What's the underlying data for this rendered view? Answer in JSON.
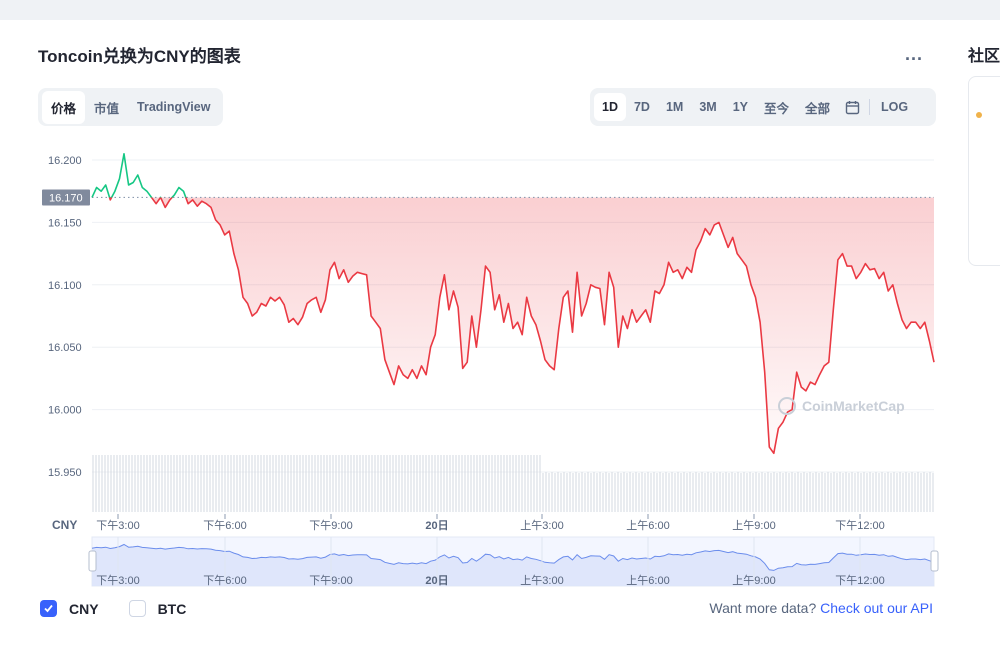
{
  "title": "Toncoin兑换为CNY的图表",
  "more_label": "...",
  "side_title": "社区",
  "view_tabs": [
    {
      "label": "价格",
      "active": true
    },
    {
      "label": "市值",
      "active": false
    },
    {
      "label": "TradingView",
      "active": false
    }
  ],
  "ranges": [
    {
      "label": "1D",
      "active": true
    },
    {
      "label": "7D",
      "active": false
    },
    {
      "label": "1M",
      "active": false
    },
    {
      "label": "3M",
      "active": false
    },
    {
      "label": "1Y",
      "active": false
    },
    {
      "label": "至今",
      "active": false
    },
    {
      "label": "全部",
      "active": false
    }
  ],
  "calendar_icon": "calendar-icon",
  "log_label": "LOG",
  "legend": [
    {
      "label": "CNY",
      "checked": true
    },
    {
      "label": "BTC",
      "checked": false
    }
  ],
  "api_text": "Want more data?",
  "api_link": "Check out our API",
  "watermark": "CoinMarketCap",
  "colors": {
    "up": "#16c784",
    "down": "#ea3943",
    "accent": "#3861fb",
    "nav_fill": "#dde4fb",
    "nav_line": "#6b8dec"
  },
  "chart_data": {
    "type": "line",
    "currency_label": "CNY",
    "ylim": [
      15.95,
      16.2
    ],
    "yticks": [
      "16.200",
      "16.150",
      "16.100",
      "16.050",
      "16.000",
      "15.950"
    ],
    "reference_price": "16.170",
    "xticks": [
      "下午3:00",
      "下午6:00",
      "下午9:00",
      "20日",
      "上午3:00",
      "上午6:00",
      "上午9:00",
      "下午12:00"
    ],
    "series": [
      {
        "values": [
          16.17,
          16.178,
          16.175,
          16.18,
          16.168,
          16.175,
          16.185,
          16.205,
          16.18,
          16.182,
          16.188,
          16.178,
          16.175,
          16.17,
          16.165,
          16.17,
          16.162,
          16.168,
          16.172,
          16.178,
          16.175,
          16.165,
          16.168,
          16.163,
          16.167,
          16.165,
          16.162,
          16.152,
          16.148,
          16.14,
          16.143,
          16.125,
          16.112,
          16.09,
          16.085,
          16.075,
          16.078,
          16.085,
          16.083,
          16.09,
          16.087,
          16.09,
          16.084,
          16.07,
          16.073,
          16.068,
          16.074,
          16.085,
          16.088,
          16.09,
          16.078,
          16.088,
          16.112,
          16.118,
          16.105,
          16.112,
          16.102,
          16.107,
          16.11,
          16.109,
          16.108,
          16.075,
          16.07,
          16.065,
          16.04,
          16.03,
          16.02,
          16.035,
          16.028,
          16.025,
          16.032,
          16.025,
          16.035,
          16.028,
          16.05,
          16.06,
          16.09,
          16.108,
          16.08,
          16.095,
          16.082,
          16.033,
          16.038,
          16.075,
          16.05,
          16.08,
          16.115,
          16.11,
          16.08,
          16.092,
          16.07,
          16.085,
          16.065,
          16.07,
          16.06,
          16.09,
          16.075,
          16.068,
          16.055,
          16.04,
          16.035,
          16.032,
          16.065,
          16.09,
          16.095,
          16.062,
          16.11,
          16.075,
          16.085,
          16.1,
          16.098,
          16.097,
          16.068,
          16.11,
          16.098,
          16.05,
          16.075,
          16.065,
          16.08,
          16.07,
          16.075,
          16.08,
          16.07,
          16.095,
          16.093,
          16.1,
          16.118,
          16.11,
          16.112,
          16.105,
          16.114,
          16.11,
          16.128,
          16.135,
          16.145,
          16.14,
          16.148,
          16.15,
          16.14,
          16.13,
          16.138,
          16.125,
          16.12,
          16.115,
          16.1,
          16.09,
          16.07,
          16.03,
          15.97,
          15.965,
          15.985,
          15.99,
          15.998,
          16.0,
          16.03,
          16.018,
          16.015,
          16.022,
          16.02,
          16.028,
          16.035,
          16.038,
          16.08,
          16.12,
          16.125,
          16.115,
          16.115,
          16.105,
          16.11,
          16.117,
          16.112,
          16.113,
          16.105,
          16.11,
          16.095,
          16.1,
          16.085,
          16.072,
          16.065,
          16.07,
          16.07,
          16.065,
          16.07,
          16.055,
          16.038
        ]
      }
    ]
  }
}
